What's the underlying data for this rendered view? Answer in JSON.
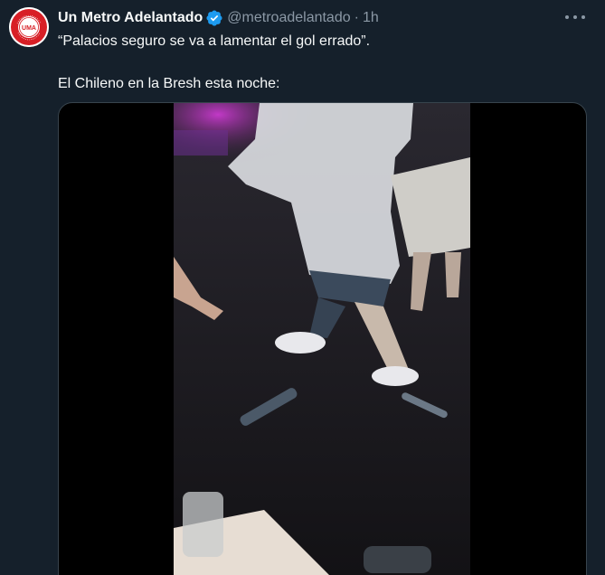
{
  "account": {
    "display_name": "Un Metro Adelantado",
    "handle": "@metroadelantado",
    "separator": "·",
    "time": "1h",
    "verified": true,
    "avatar_lettering": "UMA",
    "avatar_ring_text": "UN METRO ADELANTADO"
  },
  "tweet": {
    "line1": "“Palacios seguro se va a lamentar el gol errado”.",
    "line2": "El Chileno en la Bresh esta noche:"
  },
  "icons": {
    "verified": "verified-badge-icon",
    "more": "more-options-icon"
  },
  "colors": {
    "background": "#15202b",
    "primary_text": "#f7f9f9",
    "secondary_text": "#8b98a5",
    "verified": "#1d9bf0",
    "brand_red": "#d81f26"
  }
}
